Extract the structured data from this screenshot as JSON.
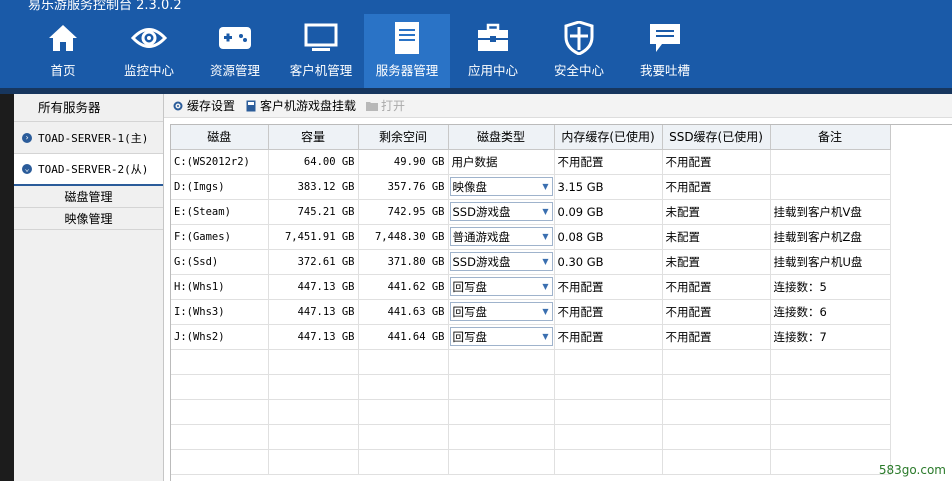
{
  "app": {
    "title": "易乐游服务控制台 2.3.0.2"
  },
  "nav": [
    {
      "label": "首页",
      "icon": "home-icon"
    },
    {
      "label": "监控中心",
      "icon": "eye-icon"
    },
    {
      "label": "资源管理",
      "icon": "gamepad-icon"
    },
    {
      "label": "客户机管理",
      "icon": "monitor-icon"
    },
    {
      "label": "服务器管理",
      "icon": "server-icon",
      "active": true
    },
    {
      "label": "应用中心",
      "icon": "toolbox-icon"
    },
    {
      "label": "安全中心",
      "icon": "shield-icon"
    },
    {
      "label": "我要吐槽",
      "icon": "chat-icon"
    }
  ],
  "sidebar": {
    "header": "所有服务器",
    "servers": [
      {
        "label": "TOAD-SERVER-1(主)"
      },
      {
        "label": "TOAD-SERVER-2(从)"
      }
    ],
    "sub_items": [
      {
        "label": "磁盘管理"
      },
      {
        "label": "映像管理"
      }
    ]
  },
  "toolbar": {
    "cache_settings": "缓存设置",
    "mount_game_disk": "客户机游戏盘挂载",
    "open": "打开"
  },
  "table": {
    "headers": [
      "磁盘",
      "容量",
      "剩余空间",
      "磁盘类型",
      "内存缓存(已使用)",
      "SSD缓存(已使用)",
      "备注"
    ],
    "rows": [
      {
        "disk": "C:(WS2012r2)",
        "capacity": "64.00 GB",
        "free": "49.90 GB",
        "type": "用户数据",
        "dropdown": false,
        "mem_cache": "不用配置",
        "ssd_cache": "不用配置",
        "note": ""
      },
      {
        "disk": "D:(Imgs)",
        "capacity": "383.12 GB",
        "free": "357.76 GB",
        "type": "映像盘",
        "dropdown": true,
        "mem_cache": "3.15 GB",
        "ssd_cache": "不用配置",
        "note": ""
      },
      {
        "disk": "E:(Steam)",
        "capacity": "745.21 GB",
        "free": "742.95 GB",
        "type": "SSD游戏盘",
        "dropdown": true,
        "mem_cache": "0.09 GB",
        "ssd_cache": "未配置",
        "note": "挂载到客户机V盘"
      },
      {
        "disk": "F:(Games)",
        "capacity": "7,451.91 GB",
        "free": "7,448.30 GB",
        "type": "普通游戏盘",
        "dropdown": true,
        "mem_cache": "0.08 GB",
        "ssd_cache": "未配置",
        "note": "挂载到客户机Z盘"
      },
      {
        "disk": "G:(Ssd)",
        "capacity": "372.61 GB",
        "free": "371.80 GB",
        "type": "SSD游戏盘",
        "dropdown": true,
        "mem_cache": "0.30 GB",
        "ssd_cache": "未配置",
        "note": "挂载到客户机U盘"
      },
      {
        "disk": "H:(Whs1)",
        "capacity": "447.13 GB",
        "free": "441.62 GB",
        "type": "回写盘",
        "dropdown": true,
        "mem_cache": "不用配置",
        "ssd_cache": "不用配置",
        "note": "连接数：5"
      },
      {
        "disk": "I:(Whs3)",
        "capacity": "447.13 GB",
        "free": "441.63 GB",
        "type": "回写盘",
        "dropdown": true,
        "mem_cache": "不用配置",
        "ssd_cache": "不用配置",
        "note": "连接数：6"
      },
      {
        "disk": "J:(Whs2)",
        "capacity": "447.13 GB",
        "free": "441.64 GB",
        "type": "回写盘",
        "dropdown": true,
        "mem_cache": "不用配置",
        "ssd_cache": "不用配置",
        "note": "连接数：7"
      }
    ]
  },
  "watermark": "583go.com",
  "colors": {
    "header_bg": "#1a5aa8",
    "active_nav": "#2a73c6"
  }
}
